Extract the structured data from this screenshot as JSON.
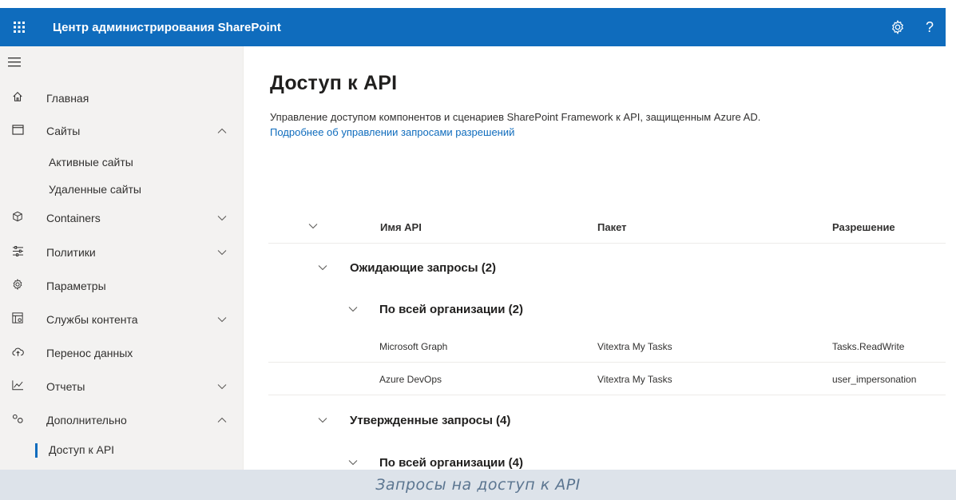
{
  "topbar": {
    "app_title": "Центр администрирования SharePoint",
    "waffle_icon": "waffle-icon",
    "settings_icon": "gear-icon",
    "help_label": "?"
  },
  "nav": {
    "items": [
      {
        "label": "Главная",
        "icon": "home-icon"
      },
      {
        "label": "Сайты",
        "icon": "sites-icon"
      },
      {
        "label": "Containers",
        "icon": "containers-icon"
      },
      {
        "label": "Политики",
        "icon": "policies-icon"
      },
      {
        "label": "Параметры",
        "icon": "gear-icon"
      },
      {
        "label": "Службы контента",
        "icon": "content-services-icon"
      },
      {
        "label": "Перенос данных",
        "icon": "migration-icon"
      },
      {
        "label": "Отчеты",
        "icon": "reports-icon"
      },
      {
        "label": "Дополнительно",
        "icon": "advanced-icon"
      }
    ],
    "sites_sub": [
      "Активные сайты",
      "Удаленные сайты"
    ],
    "advanced_sub": [
      "Доступ к API"
    ]
  },
  "main": {
    "title": "Доступ к API",
    "description": "Управление доступом компонентов и сценариев SharePoint Framework к API, защищенным Azure AD.",
    "link": "Подробнее об управлении запросами разрешений",
    "table": {
      "headers": [
        "Имя API",
        "Пакет",
        "Разрешение"
      ],
      "groups": [
        {
          "label": "Ожидающие запросы (2)",
          "subgroup": "По всей организации (2)",
          "rows": [
            {
              "api": "Microsoft Graph",
              "package": "Vitextra My Tasks",
              "permission": "Tasks.ReadWrite"
            },
            {
              "api": "Azure DevOps",
              "package": "Vitextra My Tasks",
              "permission": "user_impersonation"
            }
          ]
        },
        {
          "label": "Утвержденные запросы (4)",
          "subgroup": "По всей организации (4)",
          "rows": []
        }
      ]
    }
  },
  "caption": "Запросы на доступ к API",
  "colors": {
    "brand": "#0f6cbd",
    "nav_bg": "#f3f2f1",
    "caption_bg": "#dde3ea",
    "caption_text": "#5b7590"
  }
}
